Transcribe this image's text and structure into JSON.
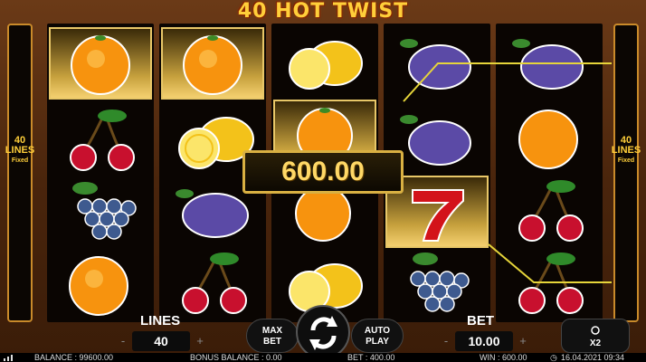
{
  "game": {
    "title": "40 HOT TWIST"
  },
  "side_panels": {
    "left": {
      "lines": "40",
      "word": "LINES",
      "mode": "Fixed"
    },
    "right": {
      "lines": "40",
      "word": "LINES",
      "mode": "Fixed"
    }
  },
  "reels": [
    [
      "orange",
      "cherries",
      "grapes",
      "orange"
    ],
    [
      "orange",
      "lemon",
      "plum",
      "cherries"
    ],
    [
      "lemon",
      "orange",
      "orange",
      "lemon"
    ],
    [
      "plum",
      "plum",
      "seven",
      "grapes"
    ],
    [
      "plum",
      "orange",
      "cherries",
      "cherries"
    ]
  ],
  "win_display": "600.00",
  "controls": {
    "lines_label": "LINES",
    "lines_value": "40",
    "bet_label": "BET",
    "bet_value": "10.00",
    "max_bet_label": "MAX\nBET",
    "auto_play_label": "AUTO\nPLAY",
    "speed_label": "X2",
    "minus": "-",
    "plus": "+"
  },
  "status_bar": {
    "balance": "BALANCE : 99600.00",
    "bonus_balance": "BONUS BALANCE : 0.00",
    "bet": "BET : 400.00",
    "win": "WIN : 600.00",
    "datetime": "16.04.2021 09:34"
  },
  "colors": {
    "accent": "#ffcf3a",
    "frame": "#c98a2a",
    "payline": "#e6d53a"
  }
}
